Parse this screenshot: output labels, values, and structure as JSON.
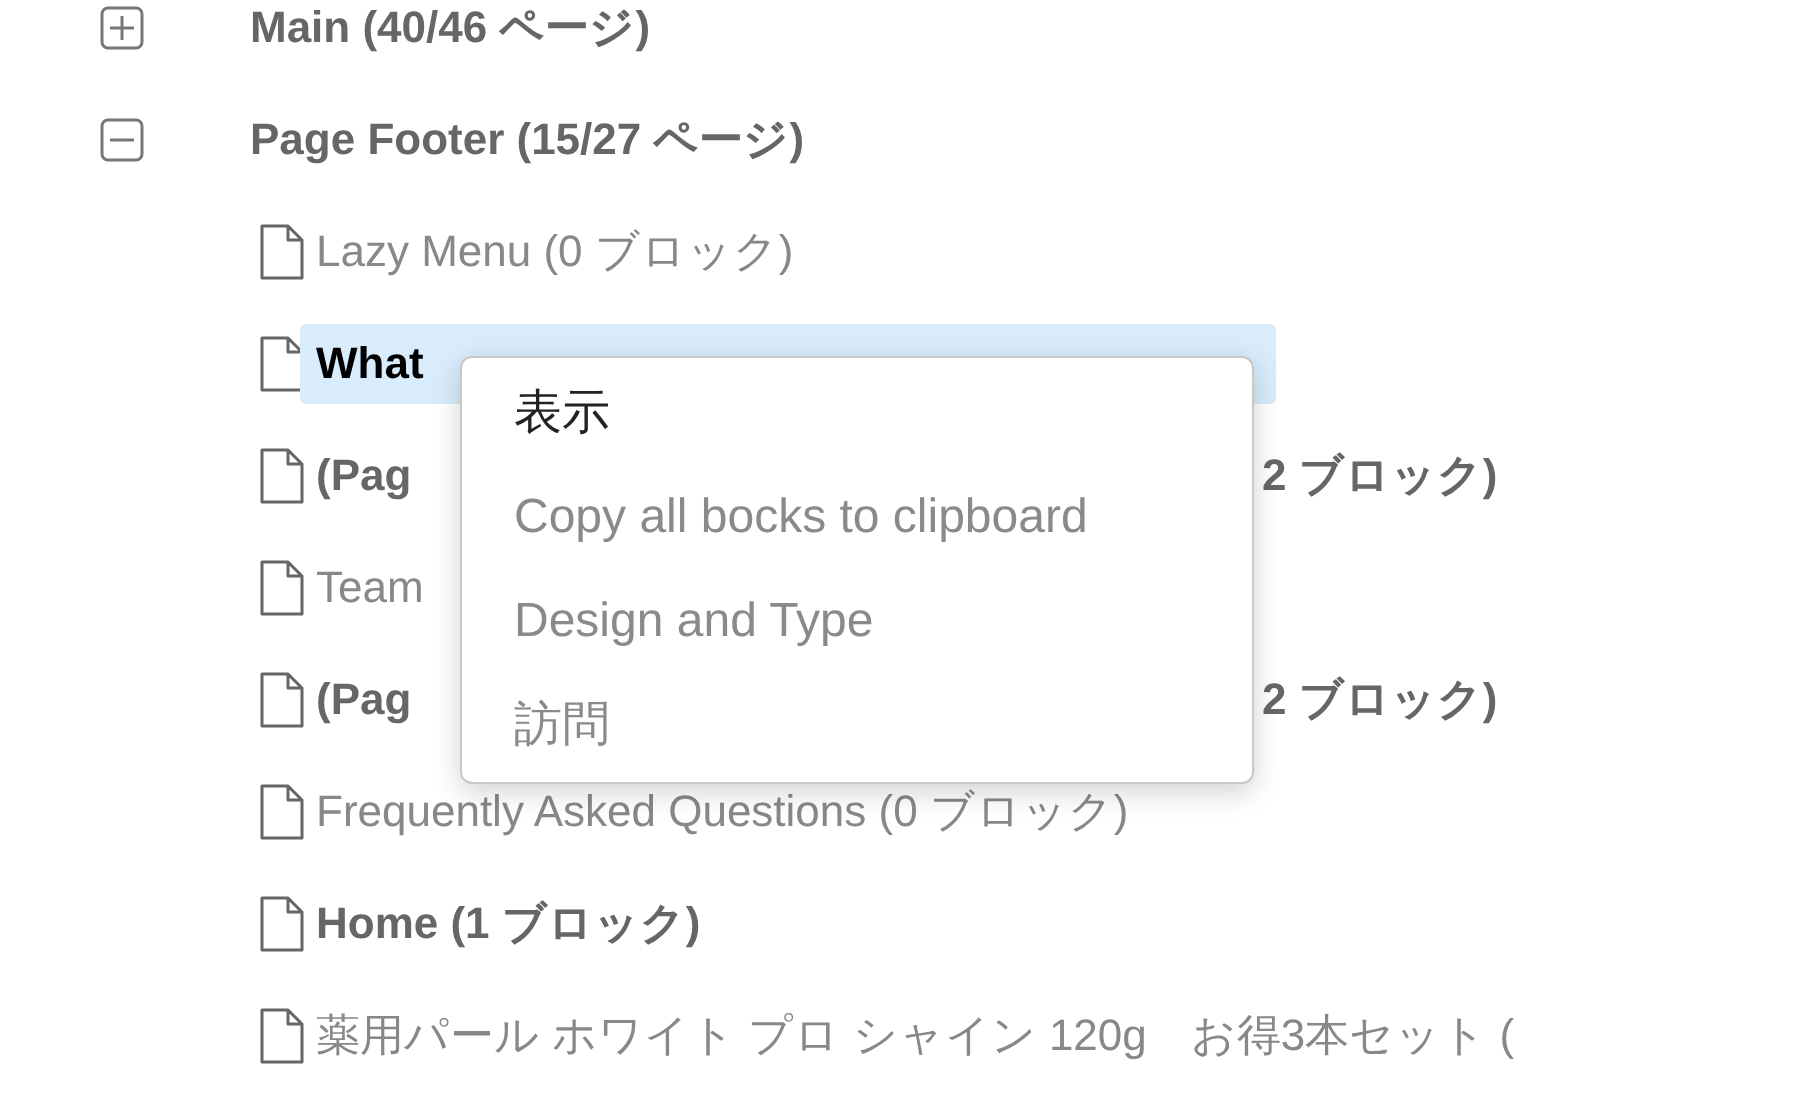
{
  "groups": [
    {
      "label": "Main (40/46 ページ)",
      "expanded": false
    },
    {
      "label": "Page Footer (15/27 ページ)",
      "expanded": true,
      "children": [
        {
          "label": "Lazy Menu (0 ブロック)",
          "bold": false,
          "selected": false
        },
        {
          "label": "What",
          "bold": true,
          "selected": true
        },
        {
          "label": "(Pag",
          "tail": "2 ブロック)",
          "bold": true,
          "selected": false
        },
        {
          "label": "Team",
          "bold": false,
          "selected": false
        },
        {
          "label": "(Pag",
          "tail": "2 ブロック)",
          "bold": true,
          "selected": false
        },
        {
          "label": "Frequently Asked Questions (0 ブロック)",
          "bold": false,
          "selected": false
        },
        {
          "label": "Home (1 ブロック)",
          "bold": true,
          "selected": false
        },
        {
          "label": "薬用パール ホワイト プロ シャイン 120g　お得3本セット (",
          "bold": false,
          "selected": false
        }
      ]
    }
  ],
  "context_menu": {
    "items": [
      {
        "label": "表示",
        "disabled": false
      },
      {
        "label": "Copy all bocks to clipboard",
        "disabled": true
      },
      {
        "label": "Design and Type",
        "disabled": true
      },
      {
        "label": "訪問",
        "disabled": true
      }
    ]
  }
}
